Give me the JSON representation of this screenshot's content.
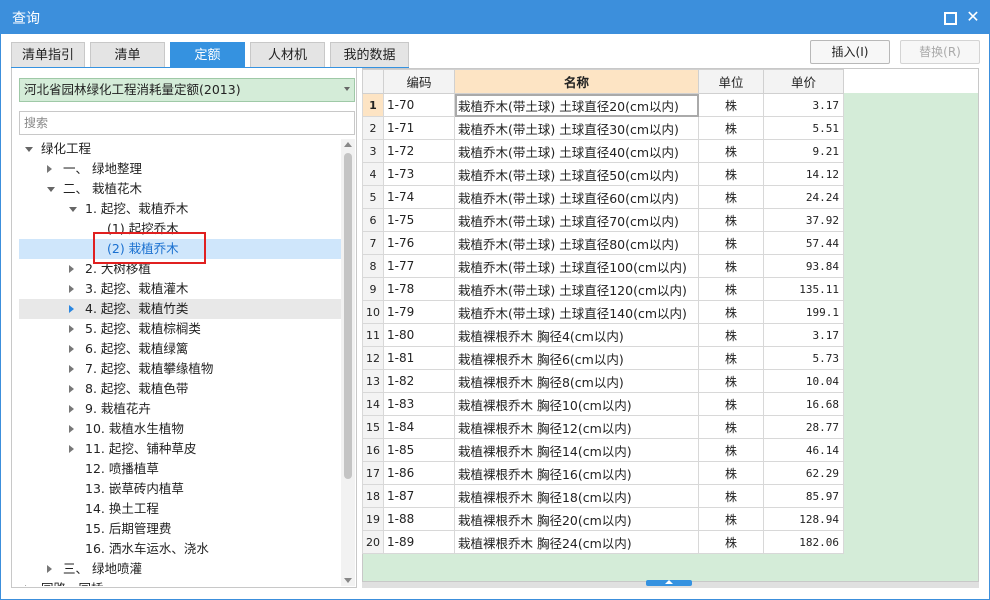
{
  "window": {
    "title": "查询"
  },
  "tabs": [
    {
      "label": "清单指引"
    },
    {
      "label": "清单"
    },
    {
      "label": "定额",
      "active": true
    },
    {
      "label": "人材机"
    },
    {
      "label": "我的数据"
    }
  ],
  "toolbar": {
    "insert_label": "插入(I)",
    "replace_label": "替换(R)"
  },
  "library": {
    "selected": "河北省园林绿化工程消耗量定额(2013)"
  },
  "search": {
    "placeholder": "搜索"
  },
  "tree": [
    {
      "label": "绿化工程",
      "caret": "down",
      "level": 0
    },
    {
      "label": "一、 绿地整理",
      "caret": "right",
      "level": 1
    },
    {
      "label": "二、 栽植花木",
      "caret": "down",
      "level": 1
    },
    {
      "label": "1. 起挖、栽植乔木",
      "caret": "down",
      "level": 2
    },
    {
      "label": "(1) 起挖乔木",
      "caret": "none",
      "level": 3
    },
    {
      "label": "(2) 栽植乔木",
      "caret": "none",
      "level": 3,
      "selected": true
    },
    {
      "label": "2. 大树移植",
      "caret": "right",
      "level": 2
    },
    {
      "label": "3. 起挖、栽植灌木",
      "caret": "right",
      "level": 2
    },
    {
      "label": "4. 起挖、栽植竹类",
      "caret": "right-blue",
      "level": 2,
      "hover": true
    },
    {
      "label": "5. 起挖、栽植棕榈类",
      "caret": "right",
      "level": 2
    },
    {
      "label": "6. 起挖、栽植绿篱",
      "caret": "right",
      "level": 2
    },
    {
      "label": "7. 起挖、栽植攀缘植物",
      "caret": "right",
      "level": 2
    },
    {
      "label": "8. 起挖、栽植色带",
      "caret": "right",
      "level": 2
    },
    {
      "label": "9. 栽植花卉",
      "caret": "right",
      "level": 2
    },
    {
      "label": "10. 栽植水生植物",
      "caret": "right",
      "level": 2
    },
    {
      "label": "11. 起挖、铺种草皮",
      "caret": "right",
      "level": 2
    },
    {
      "label": "12. 喷播植草",
      "caret": "none",
      "level": 2
    },
    {
      "label": "13. 嵌草砖内植草",
      "caret": "none",
      "level": 2
    },
    {
      "label": "14. 换土工程",
      "caret": "none",
      "level": 2
    },
    {
      "label": "15. 后期管理费",
      "caret": "none",
      "level": 2
    },
    {
      "label": "16. 洒水车运水、浇水",
      "caret": "none",
      "level": 2
    },
    {
      "label": "三、 绿地喷灌",
      "caret": "right",
      "level": 1
    },
    {
      "label": "园路、园桥",
      "caret": "right",
      "level": 0
    }
  ],
  "grid": {
    "columns": {
      "code": "编码",
      "name": "名称",
      "unit": "单位",
      "price": "单价"
    },
    "rows": [
      {
        "n": "1",
        "code": "1-70",
        "name": "栽植乔木(带土球) 土球直径20(cm以内)",
        "unit": "株",
        "price": "3.17"
      },
      {
        "n": "2",
        "code": "1-71",
        "name": "栽植乔木(带土球) 土球直径30(cm以内)",
        "unit": "株",
        "price": "5.51"
      },
      {
        "n": "3",
        "code": "1-72",
        "name": "栽植乔木(带土球) 土球直径40(cm以内)",
        "unit": "株",
        "price": "9.21"
      },
      {
        "n": "4",
        "code": "1-73",
        "name": "栽植乔木(带土球) 土球直径50(cm以内)",
        "unit": "株",
        "price": "14.12"
      },
      {
        "n": "5",
        "code": "1-74",
        "name": "栽植乔木(带土球) 土球直径60(cm以内)",
        "unit": "株",
        "price": "24.24"
      },
      {
        "n": "6",
        "code": "1-75",
        "name": "栽植乔木(带土球) 土球直径70(cm以内)",
        "unit": "株",
        "price": "37.92"
      },
      {
        "n": "7",
        "code": "1-76",
        "name": "栽植乔木(带土球) 土球直径80(cm以内)",
        "unit": "株",
        "price": "57.44"
      },
      {
        "n": "8",
        "code": "1-77",
        "name": "栽植乔木(带土球) 土球直径100(cm以内)",
        "unit": "株",
        "price": "93.84"
      },
      {
        "n": "9",
        "code": "1-78",
        "name": "栽植乔木(带土球) 土球直径120(cm以内)",
        "unit": "株",
        "price": "135.11"
      },
      {
        "n": "10",
        "code": "1-79",
        "name": "栽植乔木(带土球) 土球直径140(cm以内)",
        "unit": "株",
        "price": "199.1"
      },
      {
        "n": "11",
        "code": "1-80",
        "name": "栽植裸根乔木 胸径4(cm以内)",
        "unit": "株",
        "price": "3.17"
      },
      {
        "n": "12",
        "code": "1-81",
        "name": "栽植裸根乔木 胸径6(cm以内)",
        "unit": "株",
        "price": "5.73"
      },
      {
        "n": "13",
        "code": "1-82",
        "name": "栽植裸根乔木 胸径8(cm以内)",
        "unit": "株",
        "price": "10.04"
      },
      {
        "n": "14",
        "code": "1-83",
        "name": "栽植裸根乔木 胸径10(cm以内)",
        "unit": "株",
        "price": "16.68"
      },
      {
        "n": "15",
        "code": "1-84",
        "name": "栽植裸根乔木 胸径12(cm以内)",
        "unit": "株",
        "price": "28.77"
      },
      {
        "n": "16",
        "code": "1-85",
        "name": "栽植裸根乔木 胸径14(cm以内)",
        "unit": "株",
        "price": "46.14"
      },
      {
        "n": "17",
        "code": "1-86",
        "name": "栽植裸根乔木 胸径16(cm以内)",
        "unit": "株",
        "price": "62.29"
      },
      {
        "n": "18",
        "code": "1-87",
        "name": "栽植裸根乔木 胸径18(cm以内)",
        "unit": "株",
        "price": "85.97"
      },
      {
        "n": "19",
        "code": "1-88",
        "name": "栽植裸根乔木 胸径20(cm以内)",
        "unit": "株",
        "price": "128.94"
      },
      {
        "n": "20",
        "code": "1-89",
        "name": "栽植裸根乔木 胸径24(cm以内)",
        "unit": "株",
        "price": "182.06"
      }
    ]
  },
  "colors": {
    "accent": "#3c8fdc",
    "grid_bg": "#d4ecd8",
    "header_highlight": "#fde4c4",
    "highlight_box": "#e02020"
  }
}
